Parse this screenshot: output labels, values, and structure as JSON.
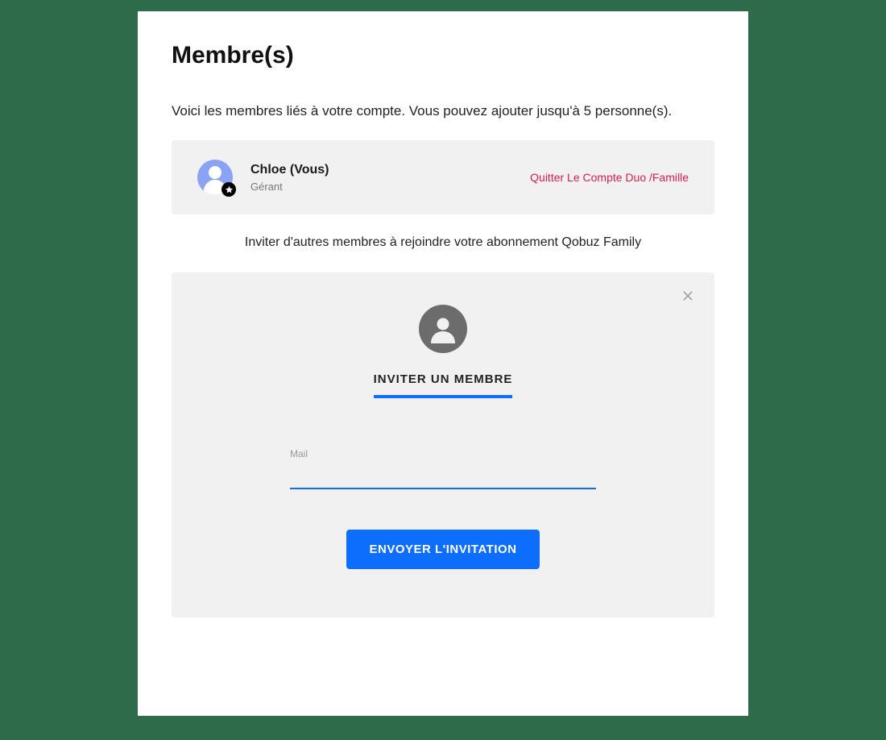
{
  "page_title": "Membre(s)",
  "intro": "Voici les membres liés à votre compte. Vous pouvez ajouter jusqu'à 5 personne(s).",
  "members": [
    {
      "name": "Chloe (Vous)",
      "role": "Gérant"
    }
  ],
  "leave_label": "Quitter Le Compte Duo /Famille",
  "invite_text": "Inviter d'autres membres à rejoindre votre abonnement Qobuz Family",
  "invite_tab": "INVITER UN MEMBRE",
  "form": {
    "email_label": "Mail",
    "email_value": "",
    "submit_label": "ENVOYER L'INVITATION"
  }
}
